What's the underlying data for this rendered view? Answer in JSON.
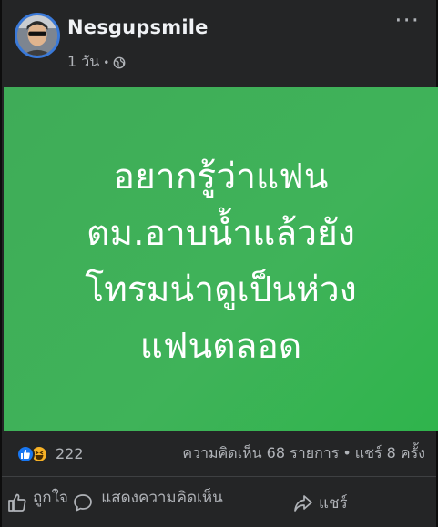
{
  "post": {
    "author": "Nesgupsmile",
    "time": "1 วัน",
    "dot": "•",
    "privacy_icon": "globe-icon",
    "more_icon": "more-icon",
    "image_text_lines": [
      "อยากรู้ว่าแฟน",
      "ตม.อาบน้ำแล้วยัง",
      "โทรมน่าดูเป็นห่วง",
      "แฟนตลอด"
    ],
    "background_color": "#3fb359"
  },
  "stats": {
    "reaction_icons": [
      "like-icon",
      "haha-icon"
    ],
    "reaction_count": "222",
    "comments": "ความคิดเห็น 68 รายการ",
    "separator": "•",
    "shares": "แชร์ 8 ครั้ง"
  },
  "actions": {
    "like_label": "ถูกใจ",
    "comment_label": "แสดงความคิดเห็น",
    "share_label": "แชร์"
  }
}
